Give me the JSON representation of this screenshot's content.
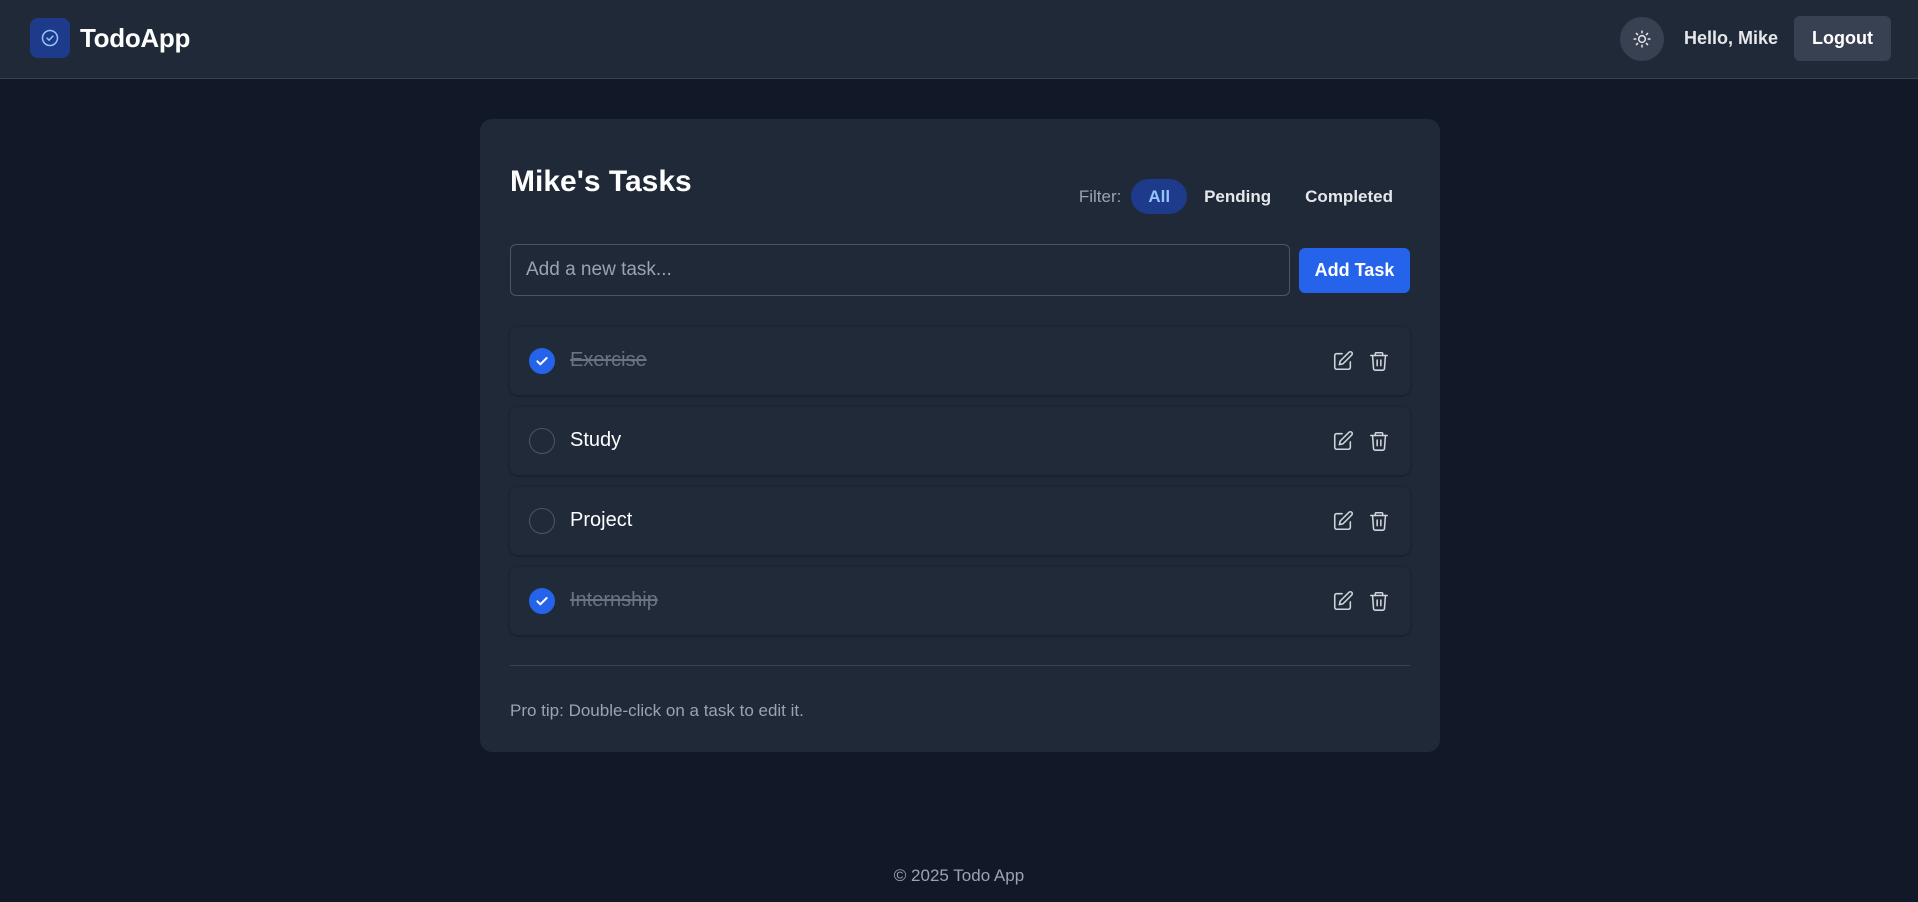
{
  "header": {
    "app_name": "TodoApp",
    "greeting": "Hello, Mike",
    "logout_label": "Logout",
    "theme_icon": "sun-icon",
    "logo_icon": "check-circle-icon"
  },
  "card": {
    "title": "Mike's Tasks",
    "filter_label": "Filter:",
    "filters": [
      {
        "label": "All",
        "active": true
      },
      {
        "label": "Pending",
        "active": false
      },
      {
        "label": "Completed",
        "active": false
      }
    ],
    "input_placeholder": "Add a new task...",
    "input_value": "",
    "add_label": "Add Task",
    "tasks": [
      {
        "text": "Exercise",
        "completed": true
      },
      {
        "text": "Study",
        "completed": false
      },
      {
        "text": "Project",
        "completed": false
      },
      {
        "text": "Internship",
        "completed": true
      }
    ],
    "tip": "Pro tip: Double-click on a task to edit it."
  },
  "footer": {
    "text": "© 2025 Todo App"
  },
  "colors": {
    "background": "#111827",
    "surface": "#1f2937",
    "accent": "#2563eb",
    "active_filter_bg": "#1e3a8a",
    "active_filter_text": "#93c5fd",
    "muted_text": "#9ca3af"
  }
}
